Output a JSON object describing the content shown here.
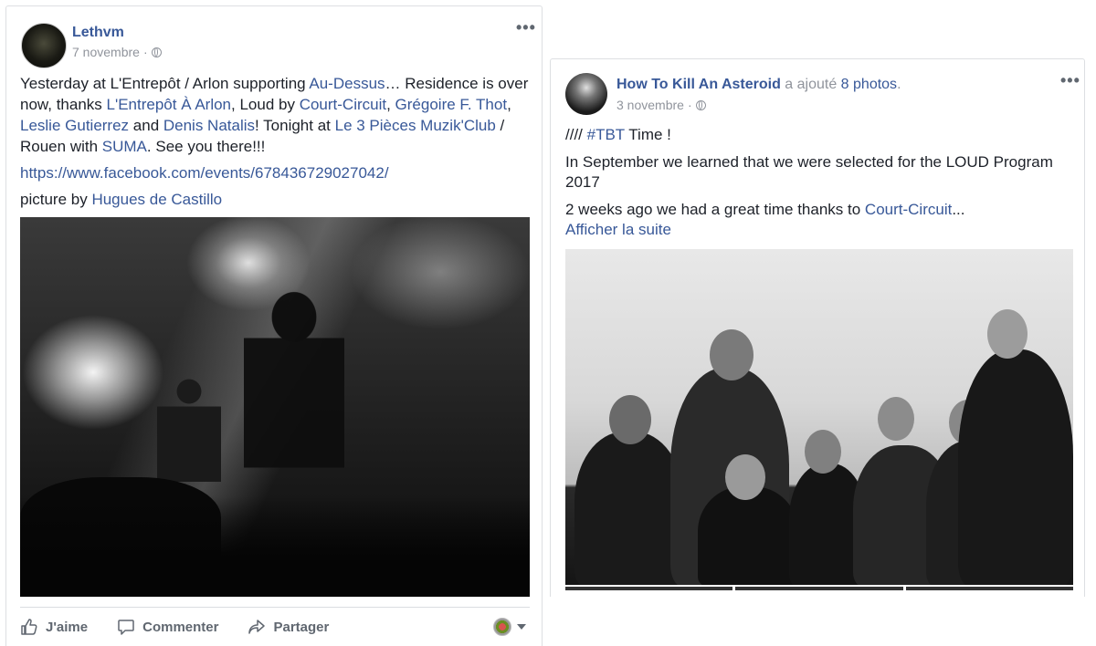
{
  "left_post": {
    "author": "Lethvm",
    "date": "7 novembre",
    "dot": "·",
    "more": "•••",
    "text": {
      "p1_a": "Yesterday at L'Entrepôt / Arlon supporting ",
      "p1_link1": "Au-Dessus",
      "p1_b": "… Residence is over now, thanks ",
      "p1_link2": "L'Entrepôt À Arlon",
      "p1_c": ", Loud by ",
      "p1_link3": "Court-Circuit",
      "p1_d": ", ",
      "p1_link4": "Grégoire F. Thot",
      "p1_e": ", ",
      "p1_link5": "Leslie Gutierrez",
      "p1_f": " and ",
      "p1_link6": "Denis Natalis",
      "p1_g": "! Tonight at ",
      "p1_link7": "Le 3 Pièces Muzik'Club",
      "p1_h": " / Rouen with ",
      "p1_link8": "SUMA",
      "p1_i": ". See you there!!!",
      "url": "https://www.facebook.com/events/678436729027042/",
      "credit_prefix": "picture by ",
      "credit_link": "Hugues de Castillo"
    },
    "actions": {
      "like": "J'aime",
      "comment": "Commenter",
      "share": "Partager"
    }
  },
  "right_post": {
    "author": "How To Kill An Asteroid",
    "added": " a ajouté ",
    "photos_link": "8 photos",
    "period": ".",
    "date": "3 novembre",
    "dot": "·",
    "more": "•••",
    "text": {
      "line1_prefix": "//// ",
      "hashtag": "#TBT",
      "line1_suffix": " Time !",
      "line2": "In September we learned that we were selected for the LOUD Program 2017",
      "line3_prefix": "2 weeks ago we had a great time thanks to ",
      "line3_link": "Court-Circuit",
      "line3_suffix": "...",
      "see_more": "Afficher la suite"
    }
  },
  "colors": {
    "link": "#385898",
    "muted": "#90949c",
    "text": "#1d2129",
    "border": "#dddfe2"
  }
}
